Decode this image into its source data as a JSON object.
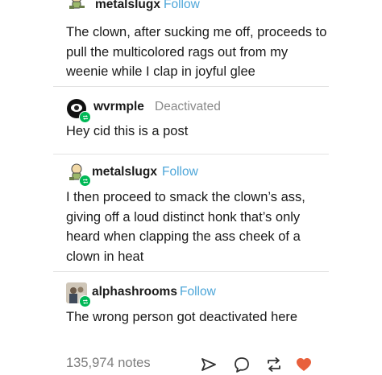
{
  "posts": [
    {
      "username": "metalslugx",
      "action": "Follow",
      "text": "The clown, after sucking me off, proceeds to pull the multicolored rags out from my weenie while I clap in joyful glee",
      "avatar_icon": "cartoon-character-avatar"
    },
    {
      "username": "wvrmple",
      "status": "Deactivated",
      "text": "Hey cid this is a post",
      "avatar_icon": "eye-ball-avatar"
    },
    {
      "username": "metalslugx",
      "action": "Follow",
      "text": "I then proceed to smack the clown’s ass, giving off a loud distinct honk that’s only heard when clapping the ass cheek of a clown in heat",
      "avatar_icon": "cartoon-character-avatar"
    },
    {
      "username": "alphashrooms",
      "action": "Follow",
      "text": "The wrong person got deactivated here",
      "avatar_icon": "photo-avatar"
    }
  ],
  "footer": {
    "notes": "135,974 notes",
    "icons": [
      "share-icon",
      "reply-icon",
      "reblog-icon",
      "like-heart-icon"
    ]
  },
  "colors": {
    "follow": "#4da6d9",
    "reblog_badge": "#00b856",
    "heart": "#e8603c",
    "muted": "#8a8a8a"
  }
}
